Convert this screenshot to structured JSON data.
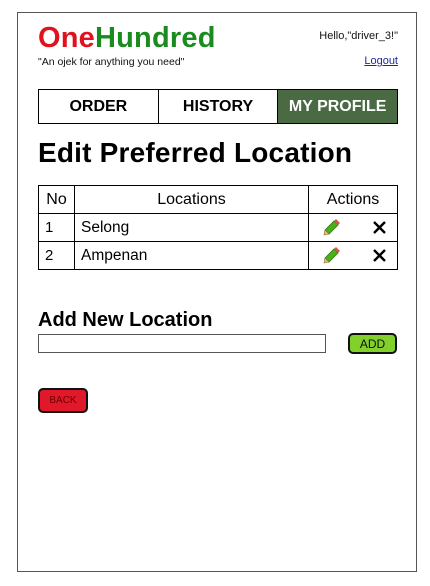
{
  "header": {
    "logo_part1": "One",
    "logo_part2": "Hundred",
    "tagline": "\"An ojek for anything you need\"",
    "greeting": "Hello,\"driver_3!\"",
    "logout_label": "Logout"
  },
  "nav": {
    "tabs": [
      {
        "label": "ORDER",
        "active": false
      },
      {
        "label": "HISTORY",
        "active": false
      },
      {
        "label": "MY PROFILE",
        "active": true
      }
    ]
  },
  "page": {
    "title": "Edit Preferred Location"
  },
  "locations_table": {
    "headers": [
      "No",
      "Locations",
      "Actions"
    ],
    "rows": [
      {
        "no": "1",
        "location": "Selong"
      },
      {
        "no": "2",
        "location": "Ampenan"
      }
    ]
  },
  "add_section": {
    "title": "Add New Location",
    "input_value": "",
    "add_label": "ADD"
  },
  "back_label": "BACK",
  "colors": {
    "logo_one": "#e0121e",
    "logo_hundred": "#1a8c1f",
    "active_tab": "#4a6a43",
    "add_button": "#82d02a",
    "back_button": "#e0182a",
    "edit_icon": "#4caf1a"
  },
  "icons": {
    "edit": "pencil-icon",
    "delete": "close-icon"
  }
}
